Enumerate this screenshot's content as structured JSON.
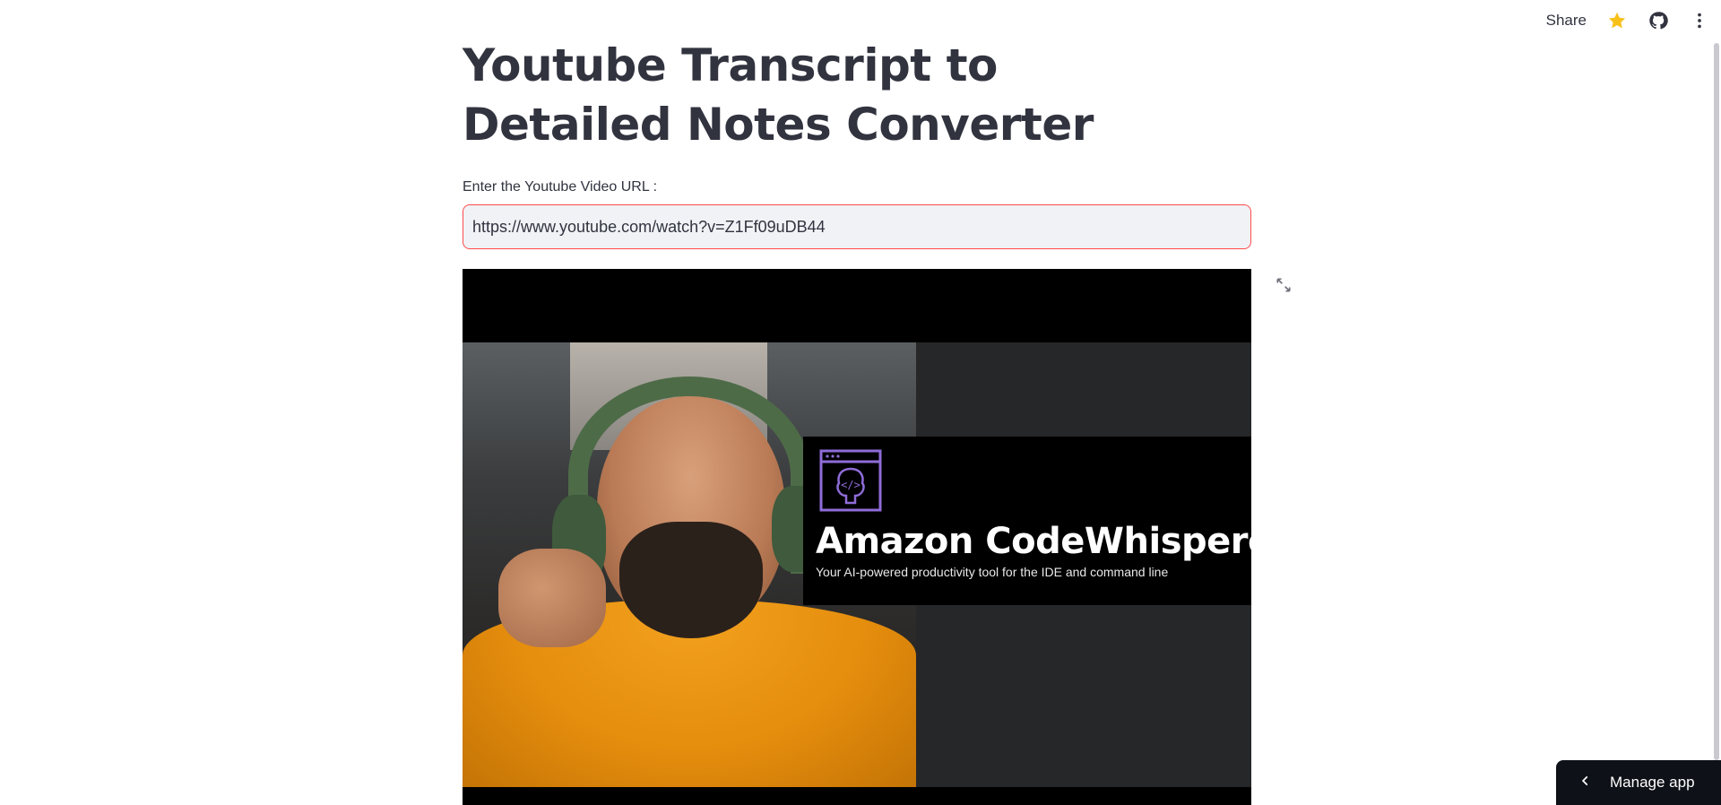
{
  "header": {
    "share_label": "Share",
    "icons": [
      "star-icon",
      "github-icon",
      "more-vertical-icon"
    ],
    "star_color": "#f8c11a"
  },
  "main": {
    "title": "Youtube Transcript to Detailed Notes Converter",
    "input_label": "Enter the Youtube Video URL :",
    "input_value": "https://www.youtube.com/watch?v=Z1Ff09uDB44",
    "input_border_color": "#ff4b4b"
  },
  "video": {
    "thumbnail_heading": "Amazon CodeWhisperer",
    "thumbnail_tagline": "Your AI-powered productivity tool for the IDE and command line",
    "expand_icon": "fullscreen-icon"
  },
  "footer": {
    "manage_label": "Manage app",
    "manage_icon": "chevron-left-icon"
  }
}
